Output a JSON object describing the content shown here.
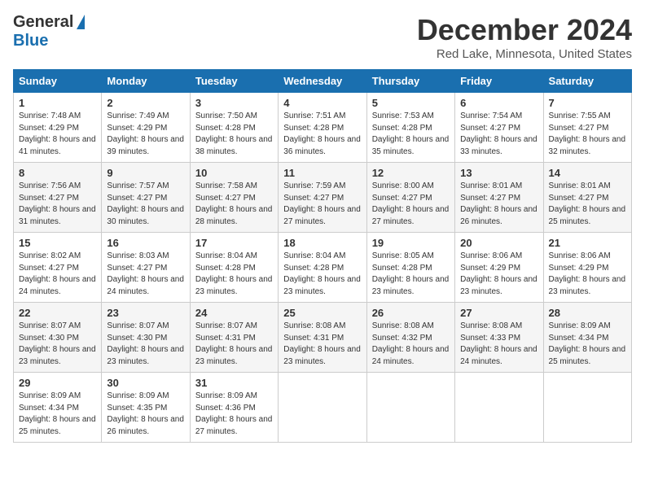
{
  "header": {
    "logo_general": "General",
    "logo_blue": "Blue",
    "title": "December 2024",
    "subtitle": "Red Lake, Minnesota, United States"
  },
  "calendar": {
    "headers": [
      "Sunday",
      "Monday",
      "Tuesday",
      "Wednesday",
      "Thursday",
      "Friday",
      "Saturday"
    ],
    "weeks": [
      [
        {
          "day": "1",
          "sunrise": "7:48 AM",
          "sunset": "4:29 PM",
          "daylight": "8 hours and 41 minutes."
        },
        {
          "day": "2",
          "sunrise": "7:49 AM",
          "sunset": "4:29 PM",
          "daylight": "8 hours and 39 minutes."
        },
        {
          "day": "3",
          "sunrise": "7:50 AM",
          "sunset": "4:28 PM",
          "daylight": "8 hours and 38 minutes."
        },
        {
          "day": "4",
          "sunrise": "7:51 AM",
          "sunset": "4:28 PM",
          "daylight": "8 hours and 36 minutes."
        },
        {
          "day": "5",
          "sunrise": "7:53 AM",
          "sunset": "4:28 PM",
          "daylight": "8 hours and 35 minutes."
        },
        {
          "day": "6",
          "sunrise": "7:54 AM",
          "sunset": "4:27 PM",
          "daylight": "8 hours and 33 minutes."
        },
        {
          "day": "7",
          "sunrise": "7:55 AM",
          "sunset": "4:27 PM",
          "daylight": "8 hours and 32 minutes."
        }
      ],
      [
        {
          "day": "8",
          "sunrise": "7:56 AM",
          "sunset": "4:27 PM",
          "daylight": "8 hours and 31 minutes."
        },
        {
          "day": "9",
          "sunrise": "7:57 AM",
          "sunset": "4:27 PM",
          "daylight": "8 hours and 30 minutes."
        },
        {
          "day": "10",
          "sunrise": "7:58 AM",
          "sunset": "4:27 PM",
          "daylight": "8 hours and 28 minutes."
        },
        {
          "day": "11",
          "sunrise": "7:59 AM",
          "sunset": "4:27 PM",
          "daylight": "8 hours and 27 minutes."
        },
        {
          "day": "12",
          "sunrise": "8:00 AM",
          "sunset": "4:27 PM",
          "daylight": "8 hours and 27 minutes."
        },
        {
          "day": "13",
          "sunrise": "8:01 AM",
          "sunset": "4:27 PM",
          "daylight": "8 hours and 26 minutes."
        },
        {
          "day": "14",
          "sunrise": "8:01 AM",
          "sunset": "4:27 PM",
          "daylight": "8 hours and 25 minutes."
        }
      ],
      [
        {
          "day": "15",
          "sunrise": "8:02 AM",
          "sunset": "4:27 PM",
          "daylight": "8 hours and 24 minutes."
        },
        {
          "day": "16",
          "sunrise": "8:03 AM",
          "sunset": "4:27 PM",
          "daylight": "8 hours and 24 minutes."
        },
        {
          "day": "17",
          "sunrise": "8:04 AM",
          "sunset": "4:28 PM",
          "daylight": "8 hours and 23 minutes."
        },
        {
          "day": "18",
          "sunrise": "8:04 AM",
          "sunset": "4:28 PM",
          "daylight": "8 hours and 23 minutes."
        },
        {
          "day": "19",
          "sunrise": "8:05 AM",
          "sunset": "4:28 PM",
          "daylight": "8 hours and 23 minutes."
        },
        {
          "day": "20",
          "sunrise": "8:06 AM",
          "sunset": "4:29 PM",
          "daylight": "8 hours and 23 minutes."
        },
        {
          "day": "21",
          "sunrise": "8:06 AM",
          "sunset": "4:29 PM",
          "daylight": "8 hours and 23 minutes."
        }
      ],
      [
        {
          "day": "22",
          "sunrise": "8:07 AM",
          "sunset": "4:30 PM",
          "daylight": "8 hours and 23 minutes."
        },
        {
          "day": "23",
          "sunrise": "8:07 AM",
          "sunset": "4:30 PM",
          "daylight": "8 hours and 23 minutes."
        },
        {
          "day": "24",
          "sunrise": "8:07 AM",
          "sunset": "4:31 PM",
          "daylight": "8 hours and 23 minutes."
        },
        {
          "day": "25",
          "sunrise": "8:08 AM",
          "sunset": "4:31 PM",
          "daylight": "8 hours and 23 minutes."
        },
        {
          "day": "26",
          "sunrise": "8:08 AM",
          "sunset": "4:32 PM",
          "daylight": "8 hours and 24 minutes."
        },
        {
          "day": "27",
          "sunrise": "8:08 AM",
          "sunset": "4:33 PM",
          "daylight": "8 hours and 24 minutes."
        },
        {
          "day": "28",
          "sunrise": "8:09 AM",
          "sunset": "4:34 PM",
          "daylight": "8 hours and 25 minutes."
        }
      ],
      [
        {
          "day": "29",
          "sunrise": "8:09 AM",
          "sunset": "4:34 PM",
          "daylight": "8 hours and 25 minutes."
        },
        {
          "day": "30",
          "sunrise": "8:09 AM",
          "sunset": "4:35 PM",
          "daylight": "8 hours and 26 minutes."
        },
        {
          "day": "31",
          "sunrise": "8:09 AM",
          "sunset": "4:36 PM",
          "daylight": "8 hours and 27 minutes."
        },
        null,
        null,
        null,
        null
      ]
    ]
  }
}
